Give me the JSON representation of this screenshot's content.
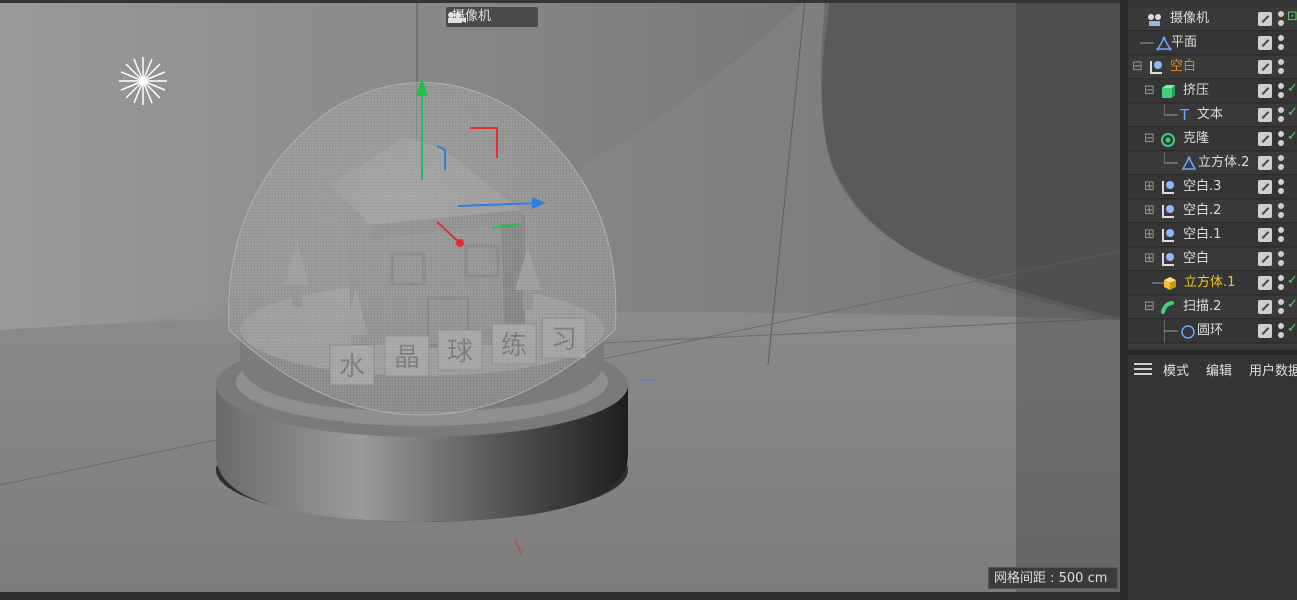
{
  "viewport": {
    "camera_label": "摄像机",
    "grid_spacing_label": "网格间距 : 500 cm",
    "globe_letters": [
      "水",
      "晶",
      "球",
      "练",
      "习"
    ]
  },
  "object_manager": {
    "rows": [
      {
        "name": "摄像机",
        "icon": "camera-icon",
        "color": "#dcdcdc"
      },
      {
        "name": "平面",
        "icon": "plane-icon",
        "color": "#dcdcdc"
      },
      {
        "name": "空白",
        "icon": "null-icon",
        "color": "#e8832a"
      },
      {
        "name": "挤压",
        "icon": "extrude-icon",
        "color": "#dcdcdc"
      },
      {
        "name": "文本",
        "icon": "text-icon",
        "color": "#dcdcdc"
      },
      {
        "name": "克隆",
        "icon": "cloner-icon",
        "color": "#dcdcdc"
      },
      {
        "name": "立方体.2",
        "icon": "cube-icon",
        "color": "#dcdcdc"
      },
      {
        "name": "空白.3",
        "icon": "null-icon",
        "color": "#dcdcdc"
      },
      {
        "name": "空白.2",
        "icon": "null-icon",
        "color": "#dcdcdc"
      },
      {
        "name": "空白.1",
        "icon": "null-icon",
        "color": "#dcdcdc"
      },
      {
        "name": "空白",
        "icon": "null-icon",
        "color": "#dcdcdc"
      },
      {
        "name": "立方体.1",
        "icon": "cube-icon",
        "color": "#f2c230"
      },
      {
        "name": "扫描.2",
        "icon": "sweep-icon",
        "color": "#dcdcdc"
      },
      {
        "name": "圆环",
        "icon": "circle-spline-icon",
        "color": "#dcdcdc"
      }
    ]
  },
  "menu": {
    "mode": "模式",
    "edit": "编辑",
    "user_data": "用户数据"
  },
  "colors": {
    "accent_orange": "#e8832a",
    "selected_yellow": "#f2c230",
    "check_green": "#5cd05c",
    "axis_y": "#20c050",
    "axis_x": "#e03030",
    "axis_z": "#2f7fe0"
  }
}
